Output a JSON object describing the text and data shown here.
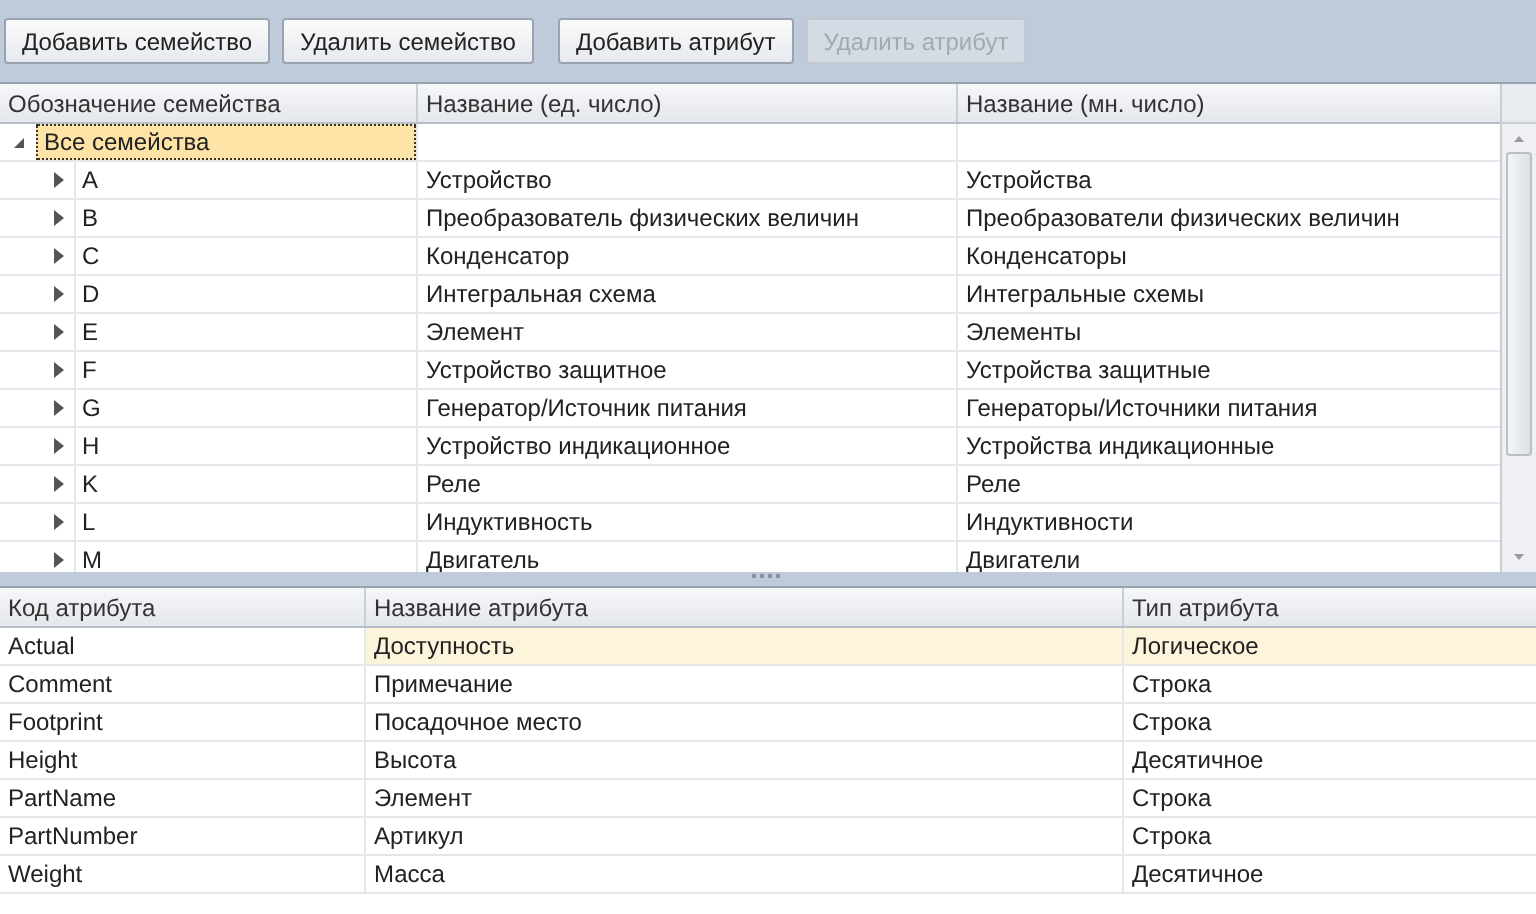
{
  "toolbar": {
    "buttons": [
      {
        "label": "Добавить семейство",
        "disabled": false
      },
      {
        "label": "Удалить семейство",
        "disabled": false
      },
      {
        "label": "Добавить атрибут",
        "disabled": false
      },
      {
        "label": "Удалить атрибут",
        "disabled": true
      }
    ]
  },
  "families": {
    "columns": [
      "Обозначение семейства",
      "Название (ед. число)",
      "Название (мн. число)"
    ],
    "tree": [
      {
        "code": "Все семейства",
        "expanded": true,
        "selected": true,
        "children": [
          {
            "code": "A",
            "singular": "Устройство",
            "plural": "Устройства",
            "expanded": false,
            "selected": false
          },
          {
            "code": "B",
            "singular": "Преобразователь физических величин",
            "plural": "Преобразователи физических величин",
            "expanded": false,
            "selected": false
          },
          {
            "code": "C",
            "singular": "Конденсатор",
            "plural": "Конденсаторы",
            "expanded": false,
            "selected": false
          },
          {
            "code": "D",
            "singular": "Интегральная схема",
            "plural": "Интегральные схемы",
            "expanded": false,
            "selected": false
          },
          {
            "code": "E",
            "singular": "Элемент",
            "plural": "Элементы",
            "expanded": false,
            "selected": false
          },
          {
            "code": "F",
            "singular": "Устройство защитное",
            "plural": "Устройства защитные",
            "expanded": false,
            "selected": false
          },
          {
            "code": "G",
            "singular": "Генератор/Источник питания",
            "plural": "Генераторы/Источники питания",
            "expanded": false,
            "selected": false
          },
          {
            "code": "H",
            "singular": "Устройство индикационное",
            "plural": "Устройства индикационные",
            "expanded": false,
            "selected": false
          },
          {
            "code": "K",
            "singular": "Реле",
            "plural": "Реле",
            "expanded": false,
            "selected": false
          },
          {
            "code": "L",
            "singular": "Индуктивность",
            "plural": "Индуктивности",
            "expanded": false,
            "selected": false
          },
          {
            "code": "M",
            "singular": "Двигатель",
            "plural": "Двигатели",
            "expanded": false,
            "selected": false
          }
        ]
      }
    ]
  },
  "attributes": {
    "columns": [
      "Код атрибута",
      "Название атрибута",
      "Тип атрибута"
    ],
    "rows": [
      {
        "code": "Actual",
        "name": "Доступность",
        "type": "Логическое",
        "selected": true
      },
      {
        "code": "Comment",
        "name": "Примечание",
        "type": "Строка",
        "selected": false
      },
      {
        "code": "Footprint",
        "name": "Посадочное место",
        "type": "Строка",
        "selected": false
      },
      {
        "code": "Height",
        "name": "Высота",
        "type": "Десятичное",
        "selected": false
      },
      {
        "code": "PartName",
        "name": "Элемент",
        "type": "Строка",
        "selected": false
      },
      {
        "code": "PartNumber",
        "name": "Артикул",
        "type": "Строка",
        "selected": false
      },
      {
        "code": "Weight",
        "name": "Масса",
        "type": "Десятичное",
        "selected": false
      }
    ]
  }
}
